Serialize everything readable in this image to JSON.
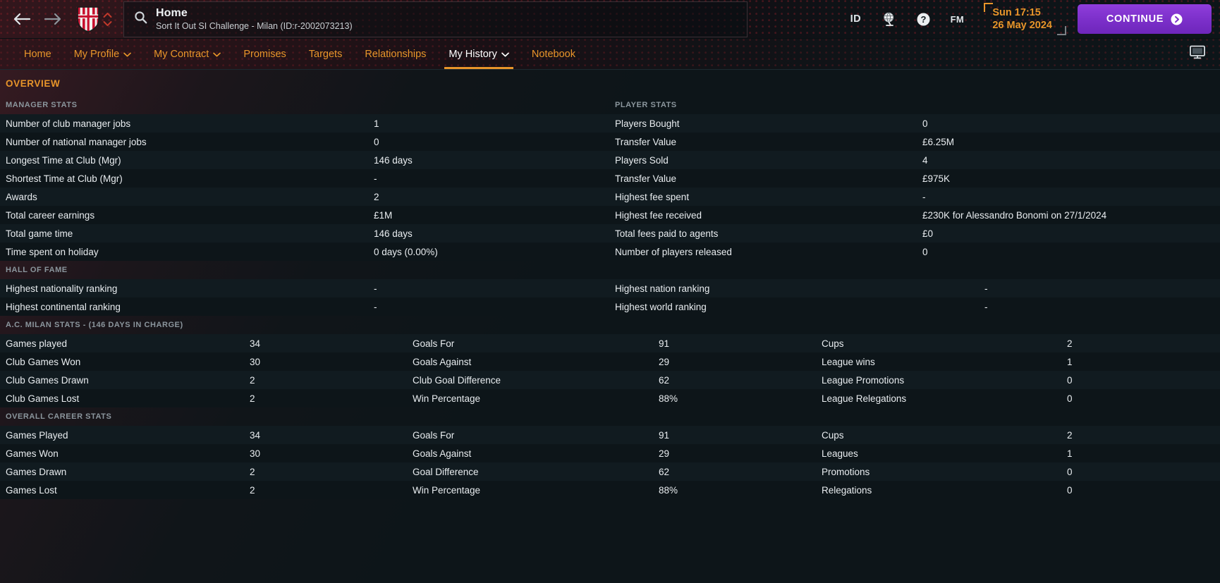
{
  "header": {
    "back_icon": "arrow-left-icon",
    "forward_icon": "arrow-right-icon",
    "crest_icon": "ac-milan-crest-icon",
    "club_switch_icon": "chevron-up-down-icon",
    "search": {
      "icon": "search-icon",
      "title": "Home",
      "subtitle": "Sort It Out SI Challenge - Milan (ID:r-2002073213)",
      "placeholder": "Search"
    },
    "right_icons": [
      {
        "name": "inbox-id-icon",
        "label": "ID"
      },
      {
        "name": "globe-icon",
        "label": ""
      },
      {
        "name": "help-icon",
        "label": "?"
      },
      {
        "name": "fm-icon",
        "label": "FM"
      }
    ],
    "date": {
      "time": "Sun 17:15",
      "day": "26 May 2024"
    },
    "continue": {
      "label": "CONTINUE",
      "icon": "chevron-right-circle-icon"
    },
    "accent_orange": "#e8952a",
    "continue_purple": "#7b2fc9"
  },
  "tabs": [
    {
      "label": "Home",
      "caret": false,
      "active": false
    },
    {
      "label": "My Profile",
      "caret": true,
      "active": false
    },
    {
      "label": "My Contract",
      "caret": true,
      "active": false
    },
    {
      "label": "Promises",
      "caret": false,
      "active": false
    },
    {
      "label": "Targets",
      "caret": false,
      "active": false
    },
    {
      "label": "Relationships",
      "caret": false,
      "active": false
    },
    {
      "label": "My History",
      "caret": true,
      "active": true
    },
    {
      "label": "Notebook",
      "caret": false,
      "active": false
    }
  ],
  "tabbar_right_icon": "monitor-icon",
  "page": {
    "overview_title": "OVERVIEW",
    "manager_stats_head": "MANAGER STATS",
    "player_stats_head": "PLAYER STATS",
    "hall_of_fame_head": "HALL OF FAME",
    "club_stats_head": "A.C. MILAN STATS - (146 DAYS IN CHARGE)",
    "career_stats_head": "OVERALL CAREER STATS"
  },
  "manager_stats": [
    {
      "label": "Number of club manager jobs",
      "value": "1"
    },
    {
      "label": "Number of national manager jobs",
      "value": "0"
    },
    {
      "label": "Longest Time at Club (Mgr)",
      "value": "146 days"
    },
    {
      "label": "Shortest Time at Club (Mgr)",
      "value": "-"
    },
    {
      "label": "Awards",
      "value": "2"
    },
    {
      "label": "Total career earnings",
      "value": "£1M"
    },
    {
      "label": "Total game time",
      "value": "146 days"
    },
    {
      "label": "Time spent on holiday",
      "value": "0 days (0.00%)"
    }
  ],
  "player_stats": [
    {
      "label": "Players Bought",
      "value": "0"
    },
    {
      "label": "Transfer Value",
      "value": "£6.25M"
    },
    {
      "label": "Players Sold",
      "value": "4"
    },
    {
      "label": "Transfer Value",
      "value": "£975K"
    },
    {
      "label": "Highest fee spent",
      "value": "-"
    },
    {
      "label": "Highest fee received",
      "value": "£230K for Alessandro Bonomi on 27/1/2024"
    },
    {
      "label": "Total fees paid to agents",
      "value": "£0"
    },
    {
      "label": "Number of players released",
      "value": "0"
    }
  ],
  "hall_of_fame_left": [
    {
      "label": "Highest nationality ranking",
      "value": "-"
    },
    {
      "label": "Highest continental ranking",
      "value": "-"
    }
  ],
  "hall_of_fame_right": [
    {
      "label": "Highest nation ranking",
      "value": "-"
    },
    {
      "label": "Highest world ranking",
      "value": "-"
    }
  ],
  "club_stats": [
    {
      "l1": "Games played",
      "v1": "34",
      "l2": "Goals For",
      "v2": "91",
      "l3": "Cups",
      "v3": "2"
    },
    {
      "l1": "Club Games Won",
      "v1": "30",
      "l2": "Goals Against",
      "v2": "29",
      "l3": "League wins",
      "v3": "1"
    },
    {
      "l1": "Club Games Drawn",
      "v1": "2",
      "l2": "Club Goal Difference",
      "v2": "62",
      "l3": "League Promotions",
      "v3": "0"
    },
    {
      "l1": "Club Games Lost",
      "v1": "2",
      "l2": "Win Percentage",
      "v2": "88%",
      "l3": "League Relegations",
      "v3": "0"
    }
  ],
  "career_stats": [
    {
      "l1": "Games Played",
      "v1": "34",
      "l2": "Goals For",
      "v2": "91",
      "l3": "Cups",
      "v3": "2"
    },
    {
      "l1": "Games Won",
      "v1": "30",
      "l2": "Goals Against",
      "v2": "29",
      "l3": "Leagues",
      "v3": "1"
    },
    {
      "l1": "Games Drawn",
      "v1": "2",
      "l2": "Goal Difference",
      "v2": "62",
      "l3": "Promotions",
      "v3": "0"
    },
    {
      "l1": "Games Lost",
      "v1": "2",
      "l2": "Win Percentage",
      "v2": "88%",
      "l3": "Relegations",
      "v3": "0"
    }
  ]
}
